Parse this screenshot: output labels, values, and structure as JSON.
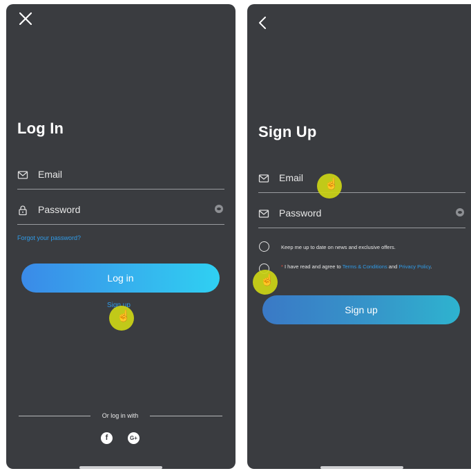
{
  "login": {
    "close_icon": "close-icon",
    "title": "Log In",
    "email_label": "Email",
    "password_label": "Password",
    "forgot_link": "Forgot your password?",
    "login_button": "Log in",
    "signup_link": "Sign up",
    "or_login_with": "Or log in with",
    "social": {
      "facebook": "f",
      "google": "G+"
    }
  },
  "signup": {
    "back_icon": "chevron-left-icon",
    "title": "Sign Up",
    "email_label": "Email",
    "password_label": "Password",
    "newsletter_text": "Keep me up to date on news and exclusive offers.",
    "agree_required_mark": "*",
    "agree_prefix": " I have read and agree to ",
    "terms_link": "Terms & Conditions",
    "agree_and": " and ",
    "privacy_link": "Privacy Policy",
    "agree_suffix": ".",
    "signup_button": "Sign up"
  },
  "colors": {
    "background": "#3a3c40",
    "link": "#2f9be8",
    "cursor_highlight": "#cdd616"
  }
}
